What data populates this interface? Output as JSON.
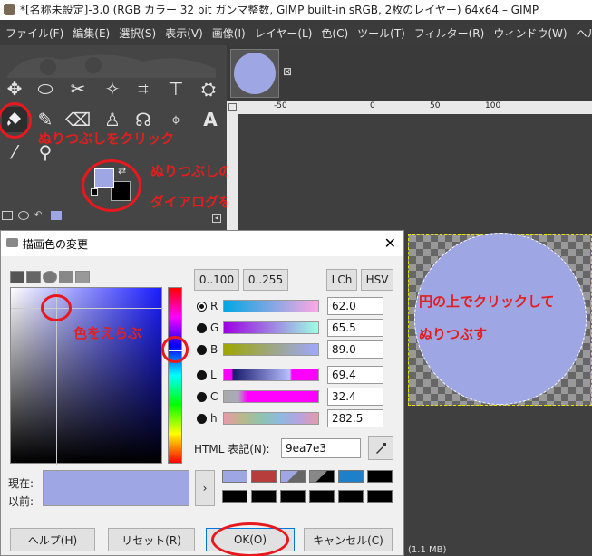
{
  "window": {
    "title": "*[名称未設定]-3.0 (RGB カラー 32 bit ガンマ整数, GIMP built-in sRGB, 2枚のレイヤー) 64x64 – GIMP"
  },
  "menu": [
    "ファイル(F)",
    "編集(E)",
    "選択(S)",
    "表示(V)",
    "画像(I)",
    "レイヤー(L)",
    "色(C)",
    "ツール(T)",
    "フィルター(R)",
    "ウィンドウ(W)",
    "ヘルプ(H)"
  ],
  "annotations": {
    "bucket": "ぬりつぶしをクリック",
    "fg_line1": "ぬりつぶしの色の",
    "fg_line2": "ダイアログをだす",
    "pick": "色をえらぶ",
    "canvas_line1": "円の上でクリックして",
    "canvas_line2": "ぬりつぶす"
  },
  "ruler": {
    "ticks": [
      "-50",
      "0",
      "50",
      "100"
    ]
  },
  "dialog": {
    "title": "描画色の変更",
    "mode_buttons": {
      "range_100": "0..100",
      "range_255": "0..255",
      "lch": "LCh",
      "hsv": "HSV"
    },
    "channels": [
      {
        "label": "R",
        "value": "62.0"
      },
      {
        "label": "G",
        "value": "65.5"
      },
      {
        "label": "B",
        "value": "89.0"
      },
      {
        "label": "L",
        "value": "69.4"
      },
      {
        "label": "C",
        "value": "32.4"
      },
      {
        "label": "h",
        "value": "282.5"
      }
    ],
    "html_label": "HTML 表記(N):",
    "html_value": "9ea7e3",
    "current_label": "現在:",
    "previous_label": "以前:",
    "buttons": {
      "help": "ヘルプ(H)",
      "reset": "リセット(R)",
      "ok": "OK(O)",
      "cancel": "キャンセル(C)"
    }
  },
  "status": {
    "memory": "(1.1 MB)"
  },
  "colors": {
    "foreground": "#9ea7e3",
    "background": "#000000",
    "annotation_red": "#e21f1f"
  }
}
